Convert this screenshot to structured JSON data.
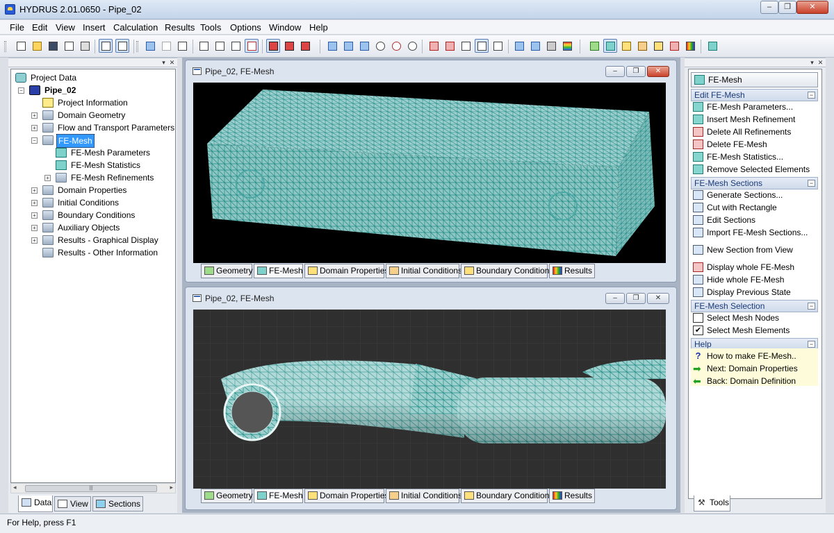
{
  "window": {
    "title": "HYDRUS 2.01.0650 - Pipe_02",
    "minimize": "‒",
    "restore": "❐",
    "close": "✕"
  },
  "menu": [
    "File",
    "Edit",
    "View",
    "Insert",
    "Calculation",
    "Results",
    "Tools",
    "Options",
    "Window",
    "Help"
  ],
  "tree": {
    "root": "Project Data",
    "project": "Pipe_02",
    "items": [
      {
        "label": "Project Information",
        "level": 2
      },
      {
        "label": "Domain Geometry",
        "level": 2
      },
      {
        "label": "Flow and Transport Parameters",
        "level": 2
      },
      {
        "label": "FE-Mesh",
        "level": 2,
        "selected": true
      },
      {
        "label": "FE-Mesh Parameters",
        "level": 3
      },
      {
        "label": "FE-Mesh Statistics",
        "level": 3
      },
      {
        "label": "FE-Mesh Refinements",
        "level": 3
      },
      {
        "label": "Domain Properties",
        "level": 2
      },
      {
        "label": "Initial Conditions",
        "level": 2
      },
      {
        "label": "Boundary Conditions",
        "level": 2
      },
      {
        "label": "Auxiliary Objects",
        "level": 2
      },
      {
        "label": "Results - Graphical Display",
        "level": 2
      },
      {
        "label": "Results - Other Information",
        "level": 2
      }
    ]
  },
  "left_tabs": [
    "Data",
    "View",
    "Sections"
  ],
  "child_windows": [
    {
      "title": "Pipe_02, FE-Mesh"
    },
    {
      "title": "Pipe_02, FE-Mesh"
    }
  ],
  "view_tabs": [
    "Geometry",
    "FE-Mesh",
    "Domain Properties",
    "Initial Conditions",
    "Boundary Conditions",
    "Results"
  ],
  "task_pane": {
    "header_button": "FE-Mesh",
    "sections": [
      {
        "title": "Edit FE-Mesh",
        "items": [
          "FE-Mesh Parameters...",
          "Insert Mesh Refinement",
          "Delete All Refinements",
          "Delete FE-Mesh",
          "FE-Mesh Statistics...",
          "Remove Selected Elements"
        ]
      },
      {
        "title": "FE-Mesh Sections",
        "items": [
          "Generate Sections...",
          "Cut with Rectangle",
          "Edit Sections",
          "Import FE-Mesh Sections...",
          "New Section from View",
          "Display whole FE-Mesh",
          "Hide whole FE-Mesh",
          "Display Previous State"
        ]
      },
      {
        "title": "FE-Mesh Selection",
        "items": [
          "Select Mesh Nodes",
          "Select Mesh Elements"
        ]
      },
      {
        "title": "Help",
        "items": [
          "How to make FE-Mesh..",
          "Next: Domain Properties",
          "Back: Domain Definition"
        ]
      }
    ],
    "select_elements_checked": true,
    "select_nodes_checked": false
  },
  "right_tab": "Tools",
  "status": "For Help, press F1",
  "colors": {
    "mesh": "#7ab8b6",
    "mesh_line": "#1f8a86",
    "viewport_top": "#000000",
    "viewport_bottom": "#2e2e2e",
    "selection": "#3399ff"
  }
}
